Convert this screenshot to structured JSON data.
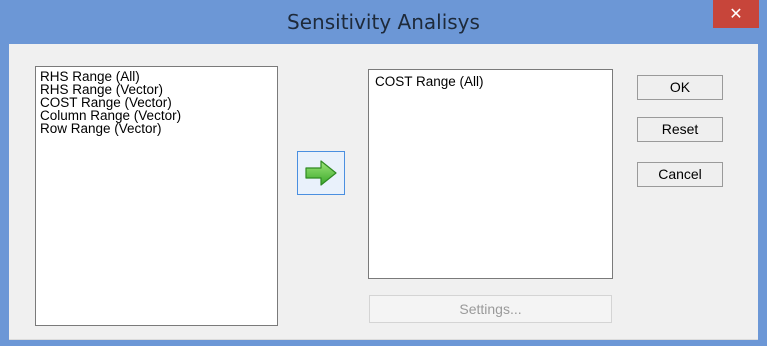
{
  "window": {
    "title": "Sensitivity Analisys",
    "close_symbol": "✕"
  },
  "available_list": {
    "items": [
      "RHS Range (All)",
      "RHS Range (Vector)",
      "COST Range (Vector)",
      "Column Range (Vector)",
      "Row Range (Vector)"
    ]
  },
  "selected_list": {
    "items": [
      "COST Range (All)"
    ]
  },
  "add_button": {
    "icon": "arrow-right-icon",
    "color": "#5fc93a"
  },
  "buttons": {
    "ok": "OK",
    "reset": "Reset",
    "cancel": "Cancel",
    "settings": "Settings...",
    "settings_enabled": false
  },
  "colors": {
    "title_bar": "#6c97d6",
    "close_button": "#c7453a",
    "dialog_background": "#f0f0f0"
  }
}
